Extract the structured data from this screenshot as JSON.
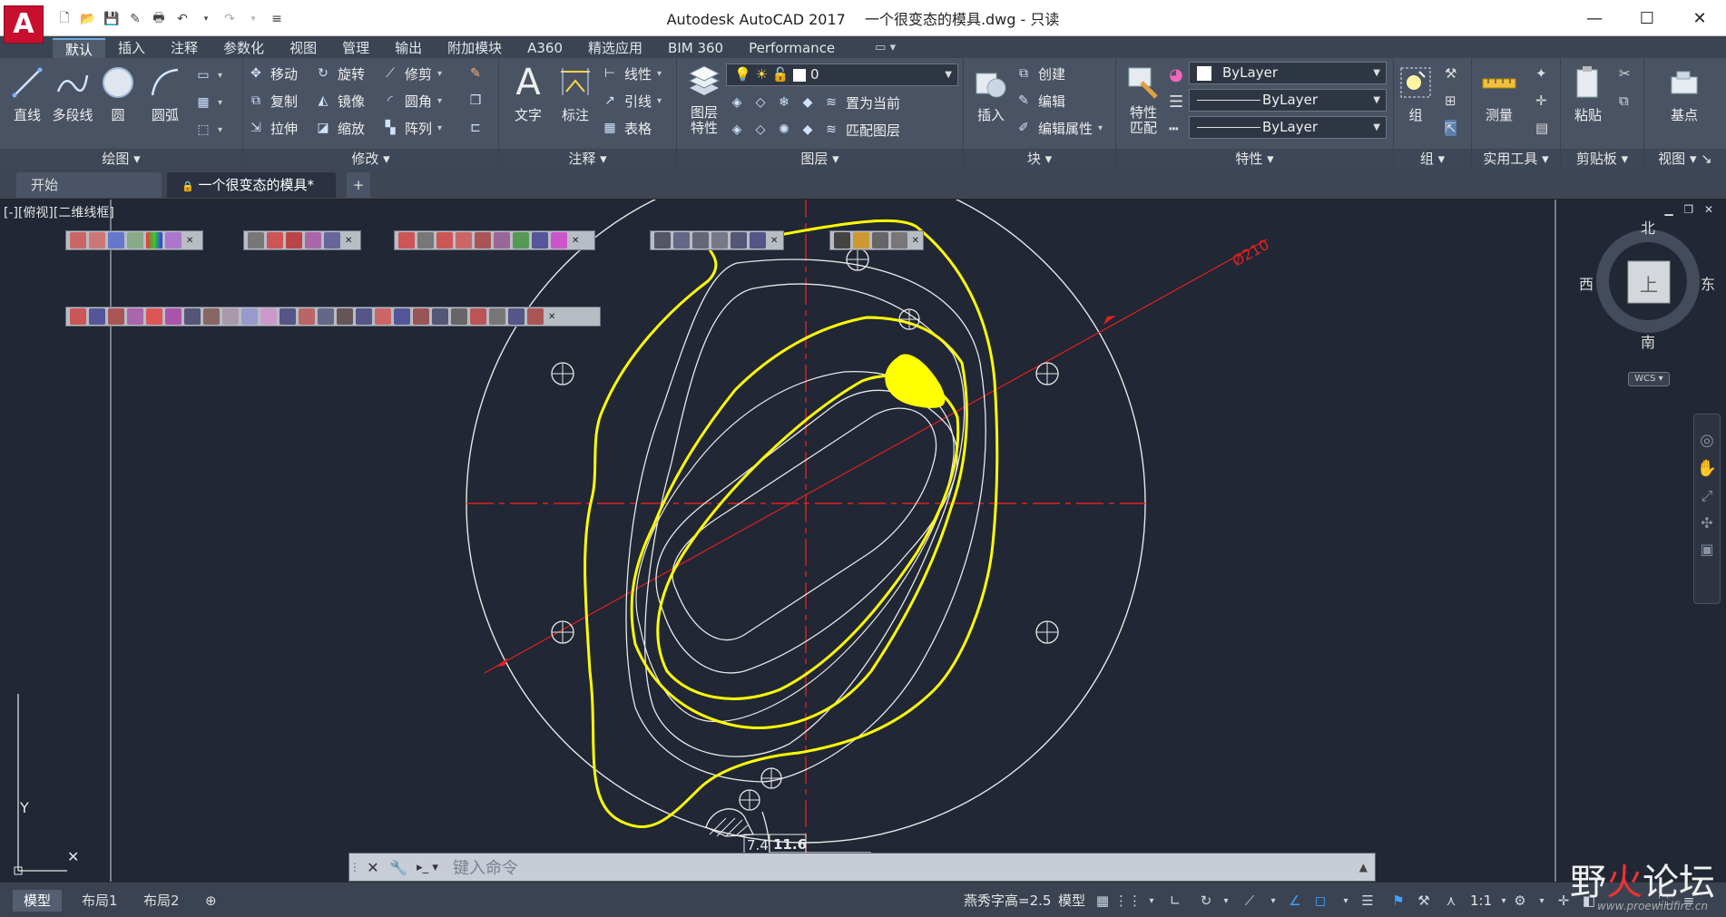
{
  "app": {
    "logo": "A",
    "title": "Autodesk AutoCAD 2017",
    "document": "一个很变态的模具.dwg - 只读"
  },
  "ribbon_tabs": [
    "默认",
    "插入",
    "注释",
    "参数化",
    "视图",
    "管理",
    "输出",
    "附加模块",
    "A360",
    "精选应用",
    "BIM 360",
    "Performance"
  ],
  "panels": {
    "draw": {
      "title": "绘图",
      "tools": [
        "直线",
        "多段线",
        "圆",
        "圆弧"
      ]
    },
    "modify": {
      "title": "修改",
      "rows": [
        [
          "移动",
          "旋转",
          "修剪"
        ],
        [
          "复制",
          "镜像",
          "圆角"
        ],
        [
          "拉伸",
          "缩放",
          "阵列"
        ]
      ]
    },
    "annotation": {
      "title": "注释",
      "big": [
        "文字",
        "标注"
      ],
      "small": [
        "线性",
        "引线",
        "表格"
      ]
    },
    "layers": {
      "title": "图层",
      "big": "图层\n特性",
      "combo": "0",
      "small": [
        "置为当前",
        "匹配图层"
      ]
    },
    "block": {
      "title": "块",
      "big": "插入",
      "small": [
        "创建",
        "编辑",
        "编辑属性"
      ]
    },
    "properties": {
      "title": "特性",
      "big": "特性\n匹配",
      "combos": [
        "ByLayer",
        "ByLayer",
        "ByLayer"
      ]
    },
    "group": {
      "title": "组",
      "big": "组"
    },
    "utilities": {
      "title": "实用工具",
      "big": "测量"
    },
    "clipboard": {
      "title": "剪贴板",
      "big": "粘贴"
    },
    "view": {
      "title": "视图",
      "big": "基点"
    }
  },
  "doc_tabs": [
    "开始",
    "一个很变态的模具*"
  ],
  "viewport_label": "[-][俯视][二维线框]",
  "viewcube": {
    "north": "北",
    "south": "南",
    "east": "东",
    "west": "西",
    "face": "上",
    "wcs": "WCS"
  },
  "drawing": {
    "dim_diameter": "Ø210",
    "dim_a": "7.4",
    "dim_b": "11.6",
    "axis_y": "Y"
  },
  "command": {
    "placeholder": "键入命令"
  },
  "layout_tabs": [
    "模型",
    "布局1",
    "布局2"
  ],
  "status": {
    "text_height": "燕秀字高=2.5",
    "space": "模型",
    "scale": "1:1"
  },
  "watermark": {
    "text_a": "野",
    "text_b": "火",
    "text_c": "论坛",
    "url": "www.proewildfire.cn"
  },
  "colors": {
    "highlight": "#ffff00",
    "center_line": "#e02020",
    "geometry": "#e8e8e8"
  }
}
